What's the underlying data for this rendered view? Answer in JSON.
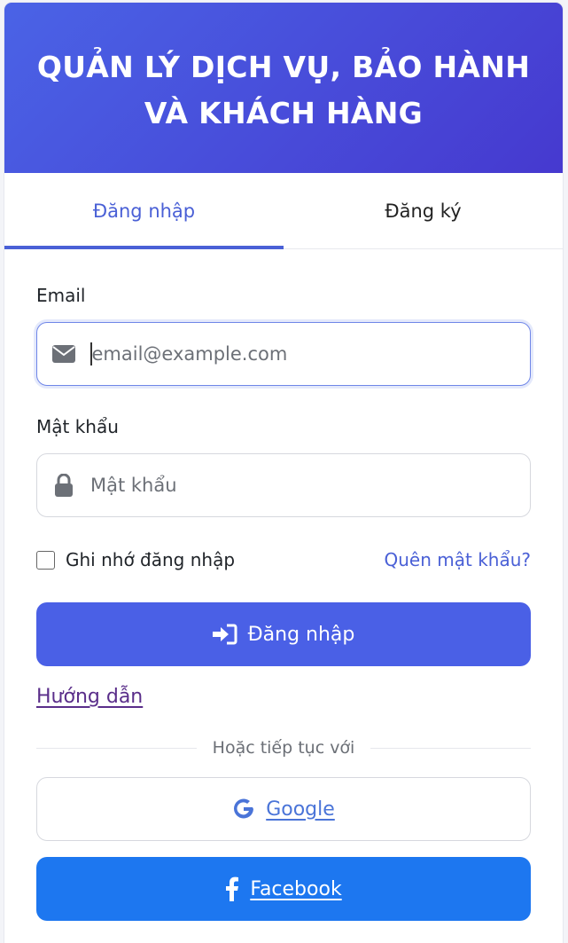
{
  "header": {
    "title_line1": "QUẢN LÝ DỊCH VỤ, BẢO HÀNH",
    "title_line2": "VÀ KHÁCH HÀNG"
  },
  "tabs": [
    {
      "label": "Đăng nhập",
      "active": true
    },
    {
      "label": "Đăng ký",
      "active": false
    }
  ],
  "form": {
    "email_label": "Email",
    "email_placeholder": "email@example.com",
    "email_icon": "envelope-icon",
    "password_label": "Mật khẩu",
    "password_placeholder": "Mật khẩu",
    "password_icon": "lock-icon",
    "remember_label": "Ghi nhớ đăng nhập",
    "remember_checked": false,
    "forgot_link": "Quên mật khẩu?",
    "login_button": "Đăng nhập",
    "login_icon": "sign-in-icon",
    "guide_link": "Hướng dẫn",
    "divider_text": "Hoặc tiếp tục với",
    "google_button": "Google",
    "google_icon": "google-icon",
    "facebook_button": "Facebook",
    "facebook_icon": "facebook-icon"
  },
  "colors": {
    "primary": "#4a60e6",
    "header_gradient_start": "#4a63e6",
    "header_gradient_end": "#4639cf",
    "facebook": "#1d77f0",
    "link_visited": "#5a2e8a"
  }
}
